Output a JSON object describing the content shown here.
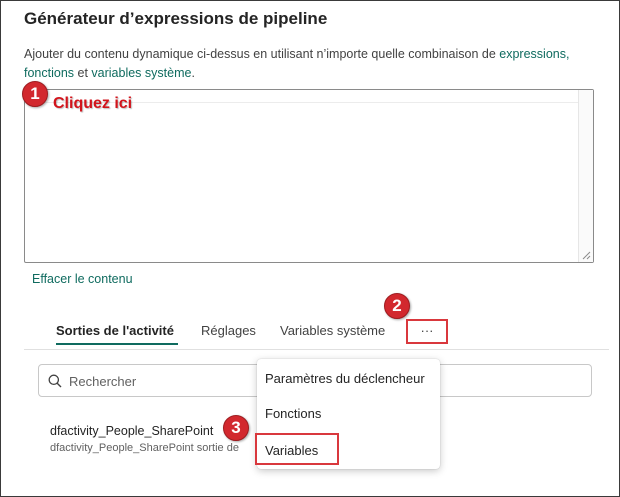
{
  "dialog": {
    "title": "Générateur d’expressions de pipeline",
    "description_prefix": "Ajouter du contenu dynamique ci-dessus en utilisant n’importe quelle combinaison de ",
    "link_expressions": "expressions,",
    "link_functions": "fonctions",
    "description_and": " et ",
    "link_system_variables": "variables système",
    "description_suffix": ".",
    "clear_label": "Effacer le contenu"
  },
  "editor": {
    "value": ""
  },
  "annotations": {
    "step1": "1",
    "step2": "2",
    "step3": "3",
    "hint": "Cliquez ici"
  },
  "tabs": [
    {
      "label": "Sorties de l'activité",
      "active": true
    },
    {
      "label": "Réglages",
      "active": false
    },
    {
      "label": "Variables système",
      "active": false
    }
  ],
  "more_button": {
    "label": "···"
  },
  "search": {
    "placeholder": "Rechercher",
    "value": ""
  },
  "activity": {
    "name": "dfactivity_People_SharePoint",
    "subtitle": "dfactivity_People_SharePoint sortie de"
  },
  "menu": {
    "items": [
      {
        "label": "Paramètres du déclencheur"
      },
      {
        "label": "Fonctions"
      },
      {
        "label": "Variables"
      }
    ]
  },
  "colors": {
    "accent": "#0f6b5f",
    "annotation_red": "#d2282e",
    "highlight_border": "#d9383d"
  }
}
